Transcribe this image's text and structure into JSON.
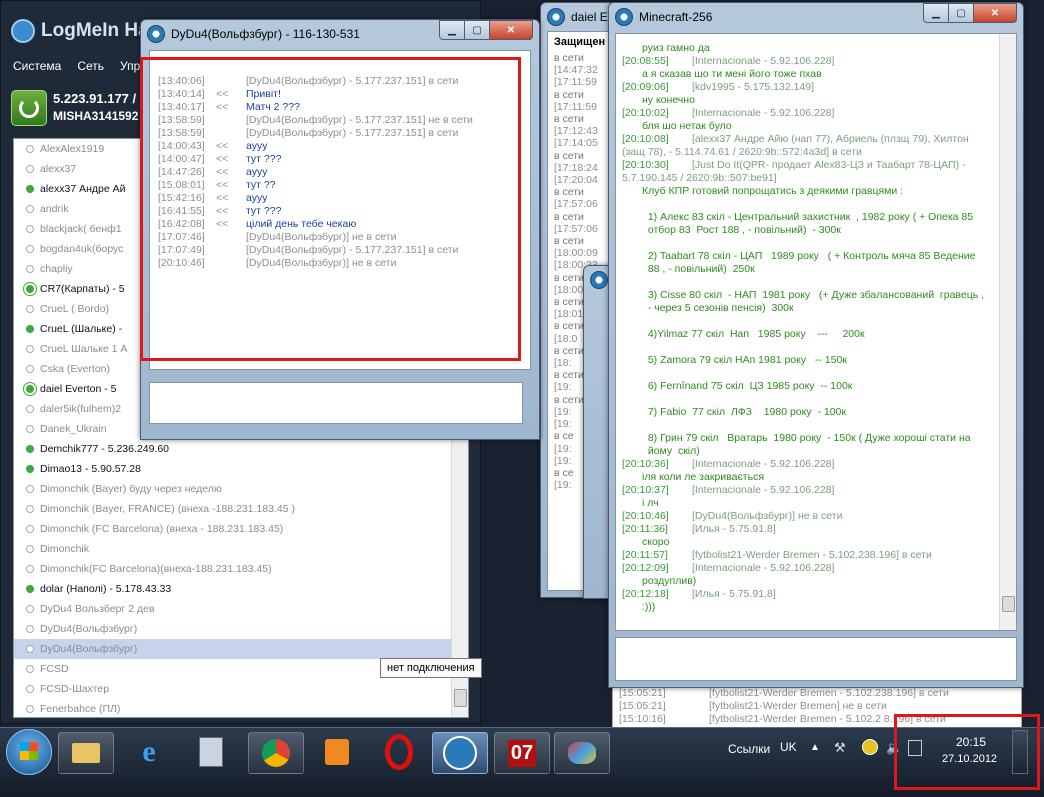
{
  "logmein": {
    "title": "LogMeIn Hamachi",
    "menu": [
      "Система",
      "Сеть",
      "Упра"
    ],
    "ip": "5.223.91.177 / 2",
    "user": "MISHA3141592",
    "contacts": [
      {
        "name": "AlexAlex1919",
        "status": "offline"
      },
      {
        "name": "alexx37",
        "status": "offline"
      },
      {
        "name": "alexx37 Андре Ай",
        "status": "online"
      },
      {
        "name": "andrik",
        "status": "offline"
      },
      {
        "name": "blackjack( бенф1",
        "status": "offline"
      },
      {
        "name": "bogdan4uk(борус",
        "status": "offline"
      },
      {
        "name": "chapliy",
        "status": "offline"
      },
      {
        "name": "CR7(Карпаты) - 5",
        "status": "relay"
      },
      {
        "name": "CrueL ( Bordo)",
        "status": "offline"
      },
      {
        "name": "CrueL (Шальке) -",
        "status": "online"
      },
      {
        "name": "CrueL Шальке 1 А",
        "status": "offline"
      },
      {
        "name": "Cska (Everton)",
        "status": "offline"
      },
      {
        "name": "daiel Everton  - 5",
        "status": "relay"
      },
      {
        "name": "daler5ik(fulhem)2",
        "status": "offline"
      },
      {
        "name": "Danek_Ukrain",
        "status": "offline"
      },
      {
        "name": "Demchik777 - 5.236.249.60",
        "status": "online"
      },
      {
        "name": "Dimao13 - 5.90.57.28",
        "status": "online"
      },
      {
        "name": "Dimonchik (Bayer) буду через неделю",
        "status": "offline"
      },
      {
        "name": "Dimonchik (Bayer, FRANCE) (внеха -188.231.183.45 )",
        "status": "offline"
      },
      {
        "name": "Dimonchik (FC Barcelona) (внеха - 188.231.183.45)",
        "status": "offline"
      },
      {
        "name": "Dimonchik",
        "status": "offline"
      },
      {
        "name": "Dimonchik(FC Barcelona)(внеха-188.231.183.45)",
        "status": "offline"
      },
      {
        "name": "dolar (Наполі) - 5.178.43.33",
        "status": "online"
      },
      {
        "name": "DyDu4 Вользберг 2 дев",
        "status": "offline"
      },
      {
        "name": "DyDu4(Вольфзбург)",
        "status": "offline"
      },
      {
        "name": "DyDu4(Вольфзбург)",
        "status": "offline",
        "selected": true
      },
      {
        "name": "FCSD",
        "status": "offline"
      },
      {
        "name": "FCSD-Шахтер",
        "status": "offline"
      },
      {
        "name": "Fenerbahce (ПЛ)",
        "status": "offline"
      }
    ],
    "tooltip": "нет подключения"
  },
  "dydu_window": {
    "title": "DyDu4(Вольфзбург) - 116-130-531",
    "lines": [
      {
        "ts": "[13:40:06]",
        "arrow": "",
        "text": "[DyDu4(Вольфзбург) - 5.177.237.151] в сети",
        "kind": "sys"
      },
      {
        "ts": "[13:40:14]",
        "arrow": "<<",
        "text": "Привіт!",
        "kind": "msg"
      },
      {
        "ts": "[13:40:17]",
        "arrow": "<<",
        "text": "Матч 2 ???",
        "kind": "msg"
      },
      {
        "ts": "[13:58:59]",
        "arrow": "",
        "text": "[DyDu4(Вольфзбург) - 5.177.237.151] не в сети",
        "kind": "sys"
      },
      {
        "ts": "[13:58:59]",
        "arrow": "",
        "text": "[DyDu4(Вольфзбург) - 5.177.237.151] в сети",
        "kind": "sys"
      },
      {
        "ts": "[14:00:43]",
        "arrow": "<<",
        "text": "аууу",
        "kind": "msg"
      },
      {
        "ts": "[14:00:47]",
        "arrow": "<<",
        "text": "тут ???",
        "kind": "msg"
      },
      {
        "ts": "[14:47:26]",
        "arrow": "<<",
        "text": "аууу",
        "kind": "msg"
      },
      {
        "ts": "[15:08:01]",
        "arrow": "<<",
        "text": "тут ??",
        "kind": "msg"
      },
      {
        "ts": "[15:42:16]",
        "arrow": "<<",
        "text": "аууу",
        "kind": "msg"
      },
      {
        "ts": "[16:41:55]",
        "arrow": "<<",
        "text": "тут ???",
        "kind": "msg"
      },
      {
        "ts": "[16:42:08]",
        "arrow": "<<",
        "text": "цілий день тебе чекаю",
        "kind": "msg"
      },
      {
        "ts": "[17:07:46]",
        "arrow": "",
        "text": "[DyDu4(Вольфзбург)] не в сети",
        "kind": "sys"
      },
      {
        "ts": "[17:07:49]",
        "arrow": "",
        "text": "[DyDu4(Вольфзбург) - 5.177.237.151] в сети",
        "kind": "sys"
      },
      {
        "ts": "[20:10:46]",
        "arrow": "",
        "text": "[DyDu4(Вольфзбург)] не в сети",
        "kind": "sys"
      }
    ]
  },
  "daiel_window": {
    "title": "daiel E",
    "header": "Защищен",
    "rows": [
      "в сети",
      "[14:47:32",
      "[17:11:59",
      "в сети",
      "[17:11:59",
      "в сети",
      "[17:12:43",
      "[17:14:05",
      "в сети",
      "[17:18:24",
      "[17:20:04",
      "в сети",
      "[17:57:06",
      "в сети",
      "[17:57:06",
      "в сети",
      "[18:00:09",
      "[18:00:23",
      "в сети",
      "[18:00:4",
      "в сети",
      "[18:01",
      "в сети",
      "[18:0",
      "в сети",
      "[18:",
      "в сети",
      "[19:",
      "в сети",
      "[19:",
      "[19:",
      "в се",
      "[19:",
      "[19:",
      "в се",
      "[19:"
    ]
  },
  "minecraft_window": {
    "title": "Minecraft-256",
    "lines": [
      {
        "kind": "txt",
        "text": "руиз гамно да"
      },
      {
        "kind": "sys",
        "ts": "[20:08:55]",
        "text": "[Internacionale - 5.92.106.228]"
      },
      {
        "kind": "txt",
        "text": "а я сказав шо ти мені його тоже пхав"
      },
      {
        "kind": "sys",
        "ts": "[20:09:06]",
        "text": "[kdv1995 - 5.175.132.149]"
      },
      {
        "kind": "txt",
        "text": "ну конечно"
      },
      {
        "kind": "sys",
        "ts": "[20:10:02]",
        "text": "[Internacionale - 5.92.106.228]"
      },
      {
        "kind": "txt",
        "text": "бля шо нетак було"
      },
      {
        "kind": "sys",
        "ts": "[20:10:08]",
        "text": "[alexx37 Андре Айю (нап 77), Абриель (плзщ 79), Хилтон"
      },
      {
        "kind": "sys",
        "ts": "",
        "text": "(защ 78),  - 5.114.74.61 / 2620:9b::572:4a3d] в сети"
      },
      {
        "kind": "sys",
        "ts": "[20:10:30]",
        "text": "[Just Do It(QPR- продает Alex83-ЦЗ и Таабарт 78-ЦАП) -"
      },
      {
        "kind": "sys",
        "ts": "",
        "text": "5.7.190.145 / 2620:9b::507:be91]"
      },
      {
        "kind": "txt",
        "text": "Клуб КПР готовий попрощатись з деякими гравцями :"
      },
      {
        "kind": "gap"
      },
      {
        "kind": "txt",
        "text": "  1) Алекс 83 скіл - Центральний захистник  , 1982 року ( + Опека 85"
      },
      {
        "kind": "txt",
        "text": "  отбор 83  Рост 188 , - повільний)  - 300к"
      },
      {
        "kind": "gap"
      },
      {
        "kind": "txt",
        "text": "  2) Taabart 78 скіл - ЦАП   1989 року   ( + Контроль мяча 85 Ведение"
      },
      {
        "kind": "txt",
        "text": "  88 , - повільний)  250к"
      },
      {
        "kind": "gap"
      },
      {
        "kind": "txt",
        "text": "  3) Cisse 80 скіл  - НАП  1981 року   (+ Дуже збалансований  гравець ,"
      },
      {
        "kind": "txt",
        "text": "  - через 5 сезонів пенсія)  300к"
      },
      {
        "kind": "gap"
      },
      {
        "kind": "txt",
        "text": "  4)Yilmaz 77 скіл  Нап   1985 року    ---     200к"
      },
      {
        "kind": "gap"
      },
      {
        "kind": "txt",
        "text": "  5) Zamora 79 скіл НАп 1981 року   -- 150к"
      },
      {
        "kind": "gap"
      },
      {
        "kind": "txt",
        "text": "  6) Fernînand 75 скіл  ЦЗ 1985 року  -- 100к"
      },
      {
        "kind": "gap"
      },
      {
        "kind": "txt",
        "text": "  7) Fabio  77 скіл  ЛФЗ    1980 року  - 100к"
      },
      {
        "kind": "gap"
      },
      {
        "kind": "txt",
        "text": "  8) Грин 79 скіл   Вратарь  1980 року  - 150к ( Дуже хороші стати на"
      },
      {
        "kind": "txt",
        "text": "  йому  скіл)"
      },
      {
        "kind": "sys",
        "ts": "[20:10:36]",
        "text": "[Internacionale - 5.92.106.228]"
      },
      {
        "kind": "txt",
        "text": "іля коли ле закривається"
      },
      {
        "kind": "sys",
        "ts": "[20:10:37]",
        "text": "[Internacionale - 5.92.106.228]"
      },
      {
        "kind": "txt",
        "text": "і лч"
      },
      {
        "kind": "sys",
        "ts": "[20:10:46]",
        "text": "[DyDu4(Вольфзбург)] не в сети"
      },
      {
        "kind": "sys",
        "ts": "[20:11:36]",
        "text": "[Илья - 5.75.91.8]"
      },
      {
        "kind": "txt",
        "text": "скоро"
      },
      {
        "kind": "sys",
        "ts": "[20:11:57]",
        "text": "[fytbolist21-Werder Bremen - 5.102.238.196] в сети"
      },
      {
        "kind": "sys",
        "ts": "[20:12:09]",
        "text": "[Internacionale - 5.92.106.228]"
      },
      {
        "kind": "txt",
        "text": "роздуплив)"
      },
      {
        "kind": "sys",
        "ts": "[20:12:18]",
        "text": "[Илья - 5.75.91.8]"
      },
      {
        "kind": "txt",
        "text": ":)))"
      }
    ]
  },
  "behind_rows": [
    {
      "ts": "[15:05:21]",
      "text": "[fytbolist21-Werder Bremen - 5.102.238.196] в сети"
    },
    {
      "ts": "[15:05:21]",
      "text": "[fytbolist21-Werder Bremen] не в сети"
    },
    {
      "ts": "[15:10:16]",
      "text": "[fytbolist21-Werder Bremen - 5.102.2  8.196] в сети"
    }
  ],
  "taskbar": {
    "tray_label": "Ссылки",
    "lang": "UK",
    "time": "20:15",
    "date": "27.10.2012",
    "app_07": "07"
  },
  "colors": {
    "highlight": "#e0161d"
  }
}
